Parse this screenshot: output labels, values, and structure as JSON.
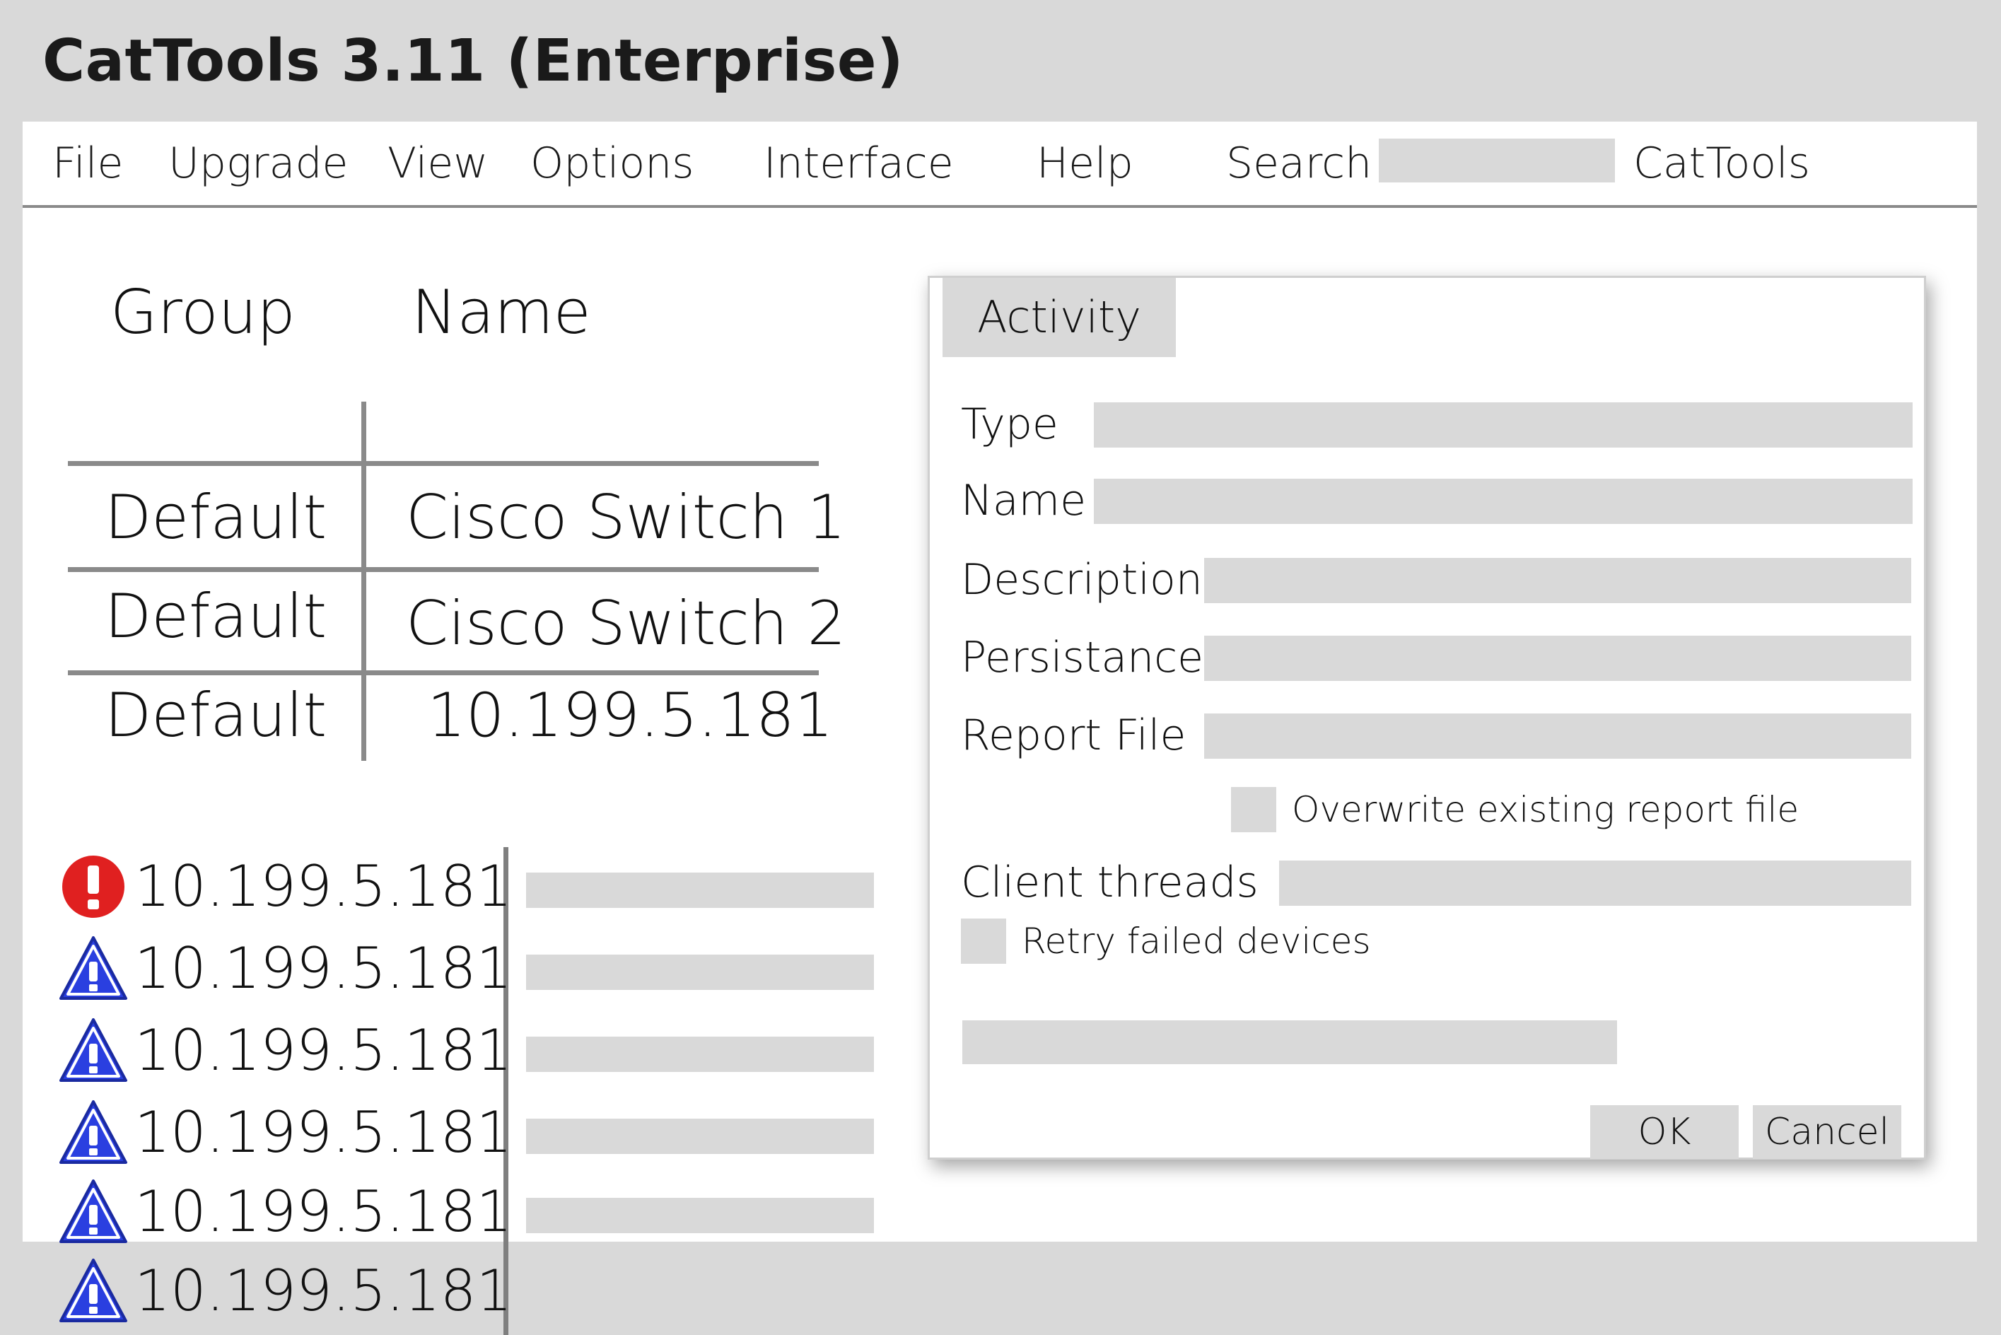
{
  "window": {
    "title": "CatTools 3.11 (Enterprise)"
  },
  "menubar": {
    "items": [
      {
        "label": "File"
      },
      {
        "label": "Upgrade"
      },
      {
        "label": "View"
      },
      {
        "label": "Options"
      },
      {
        "label": "Interface"
      },
      {
        "label": "Help"
      },
      {
        "label": "Search"
      },
      {
        "label": "CatTools"
      }
    ],
    "search_value": ""
  },
  "device_table": {
    "columns": [
      "Group",
      "Name"
    ],
    "rows": [
      {
        "group": "Default",
        "name": "Cisco Switch 1"
      },
      {
        "group": "Default",
        "name": "Cisco Switch 2"
      },
      {
        "group": "Default",
        "name": "10.199.5.181"
      }
    ]
  },
  "activity_log": {
    "rows": [
      {
        "icon": "error-icon",
        "ip": "10.199.5.181"
      },
      {
        "icon": "warning-icon",
        "ip": "10.199.5.181"
      },
      {
        "icon": "warning-icon",
        "ip": "10.199.5.181"
      },
      {
        "icon": "warning-icon",
        "ip": "10.199.5.181"
      },
      {
        "icon": "warning-icon",
        "ip": "10.199.5.181"
      },
      {
        "icon": "warning-icon",
        "ip": "10.199.5.181"
      }
    ],
    "colors": {
      "error": "#e02020",
      "warning": "#2a3fe0"
    }
  },
  "dialog": {
    "tab": "Activity",
    "fields": {
      "type": {
        "label": "Type",
        "value": ""
      },
      "name": {
        "label": "Name",
        "value": ""
      },
      "description": {
        "label": "Description",
        "value": ""
      },
      "persistance": {
        "label": "Persistance",
        "value": ""
      },
      "report_file": {
        "label": "Report File",
        "value": ""
      },
      "client_threads": {
        "label": "Client threads",
        "value": ""
      }
    },
    "overwrite_label": "Overwrite existing report file",
    "retry_label": "Retry failed devices",
    "ok_label": "OK",
    "cancel_label": "Cancel"
  }
}
